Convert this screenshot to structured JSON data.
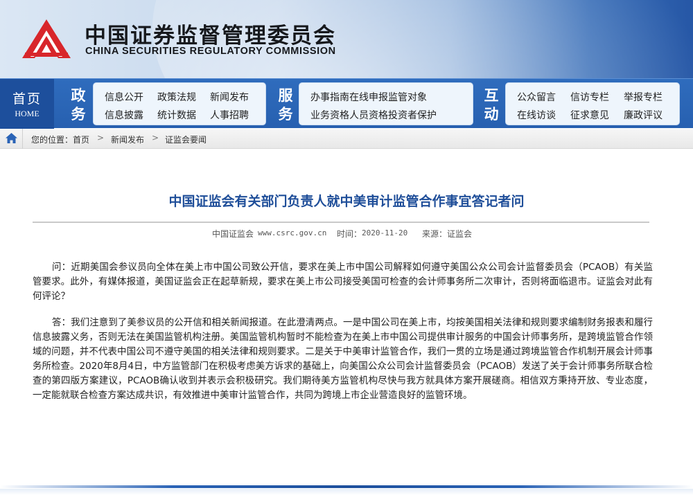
{
  "brand": {
    "name_cn": "中国证券监督管理委员会",
    "name_en": "CHINA SECURITIES REGULATORY COMMISSION",
    "logo_icon": "csrc-logo-icon",
    "colors": {
      "primary": "#2760b0",
      "logo_red": "#d8262b",
      "title": "#1f4e99"
    }
  },
  "nav": {
    "home": {
      "cn": "首页",
      "en": "HOME"
    },
    "groups": [
      {
        "cat": [
          "政",
          "务"
        ],
        "links": [
          "信息公开",
          "政策法规",
          "新闻发布",
          "信息披露",
          "统计数据",
          "人事招聘"
        ]
      },
      {
        "cat": [
          "服",
          "务"
        ],
        "links": [
          "办事指南",
          "在线申报",
          "监管对象",
          "业务资格",
          "人员资格",
          "投资者保护"
        ]
      },
      {
        "cat": [
          "互",
          "动"
        ],
        "links": [
          "公众留言",
          "信访专栏",
          "举报专栏",
          "在线访谈",
          "征求意见",
          "廉政评议"
        ]
      }
    ]
  },
  "breadcrumb": {
    "home_icon": "home-icon",
    "prefix": "您的位置：",
    "items": [
      "首页",
      "新闻发布",
      "证监会要闻"
    ],
    "separator": ">"
  },
  "article": {
    "title": "中国证监会有关部门负责人就中美审计监管合作事宜答记者问",
    "meta": {
      "site": "中国证监会",
      "url": "www.csrc.gov.cn",
      "time_label": "时间：",
      "time": "2020-11-20",
      "source_label": "来源：",
      "source": "证监会"
    },
    "paragraphs": [
      "问：近期美国会参议员向全体在美上市中国公司致公开信，要求在美上市中国公司解释如何遵守美国公众公司会计监督委员会（PCAOB）有关监管要求。此外，有媒体报道，美国证监会正在起草新规，要求在美上市公司接受美国可检查的会计师事务所二次审计，否则将面临退市。证监会对此有何评论？",
      "答：我们注意到了美参议员的公开信和相关新闻报道。在此澄清两点。一是中国公司在美上市，均按美国相关法律和规则要求编制财务报表和履行信息披露义务，否则无法在美国监管机构注册。美国监管机构暂时不能检查为在美上市中国公司提供审计服务的中国会计师事务所，是跨境监管合作领域的问题，并不代表中国公司不遵守美国的相关法律和规则要求。二是关于中美审计监管合作，我们一贯的立场是通过跨境监管合作机制开展会计师事务所检查。2020年8月4日，中方监管部门在积极考虑美方诉求的基础上，向美国公众公司会计监督委员会（PCAOB）发送了关于会计师事务所联合检查的第四版方案建议，PCAOB确认收到并表示会积极研究。我们期待美方监管机构尽快与我方就具体方案开展磋商。相信双方秉持开放、专业态度，一定能就联合检查方案达成共识，有效推进中美审计监管合作，共同为跨境上市企业营造良好的监管环境。"
    ]
  }
}
